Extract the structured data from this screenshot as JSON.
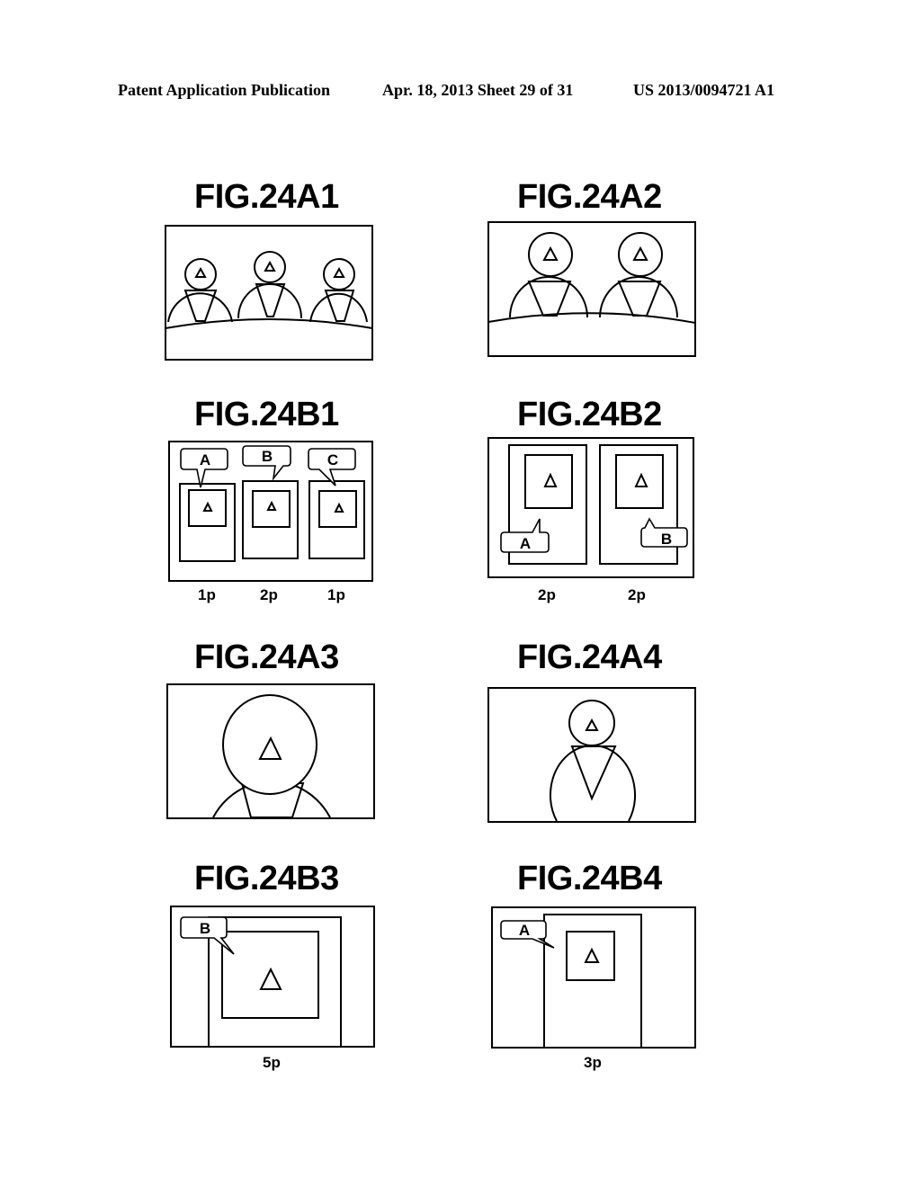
{
  "header": {
    "publication": "Patent Application Publication",
    "date_sheet": "Apr. 18, 2013  Sheet 29 of 31",
    "patent_number": "US 2013/0094721 A1"
  },
  "figures": {
    "a1": {
      "title": "FIG.24A1"
    },
    "a2": {
      "title": "FIG.24A2"
    },
    "b1": {
      "title": "FIG.24B1",
      "bubbles": [
        "A",
        "B",
        "C"
      ],
      "captions": [
        "1p",
        "2p",
        "1p"
      ]
    },
    "b2": {
      "title": "FIG.24B2",
      "bubbles": [
        "A",
        "B"
      ],
      "captions": [
        "2p",
        "2p"
      ]
    },
    "a3": {
      "title": "FIG.24A3"
    },
    "a4": {
      "title": "FIG.24A4"
    },
    "b3": {
      "title": "FIG.24B3",
      "bubbles": [
        "B"
      ],
      "captions": [
        "5p"
      ]
    },
    "b4": {
      "title": "FIG.24B4",
      "bubbles": [
        "A"
      ],
      "captions": [
        "3p"
      ]
    }
  }
}
